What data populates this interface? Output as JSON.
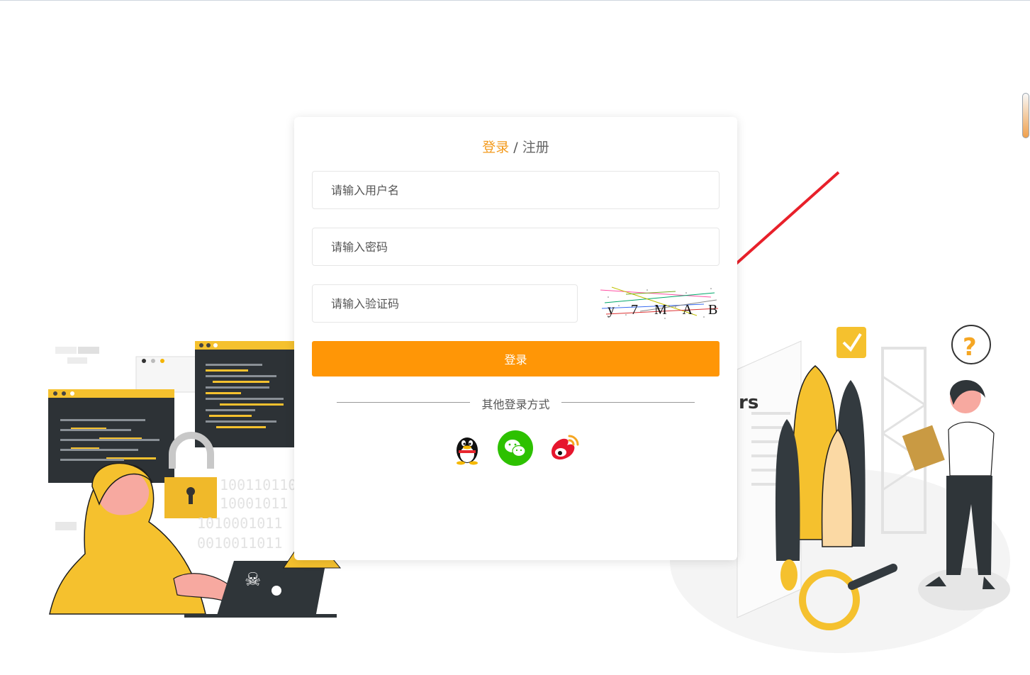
{
  "tabs": {
    "login": "登录",
    "separator": "/",
    "register": "注册"
  },
  "form": {
    "username_placeholder": "请输入用户名",
    "password_placeholder": "请输入密码",
    "captcha_placeholder": "请输入验证码",
    "captcha_text": "y 7 M A B",
    "login_button": "登录"
  },
  "other_login": {
    "label": "其他登录方式",
    "providers": [
      "qq-icon",
      "wechat-icon",
      "weibo-icon"
    ]
  },
  "illustration_left": {
    "binary_rows": [
      "100110110",
      "10001011",
      "1010001011",
      "0010011011"
    ]
  },
  "colors": {
    "accent": "#ff9606",
    "tab_active": "#f39a1c",
    "wechat": "#2dc100",
    "weibo": "#e6162d",
    "arrow": "#e8202a"
  }
}
